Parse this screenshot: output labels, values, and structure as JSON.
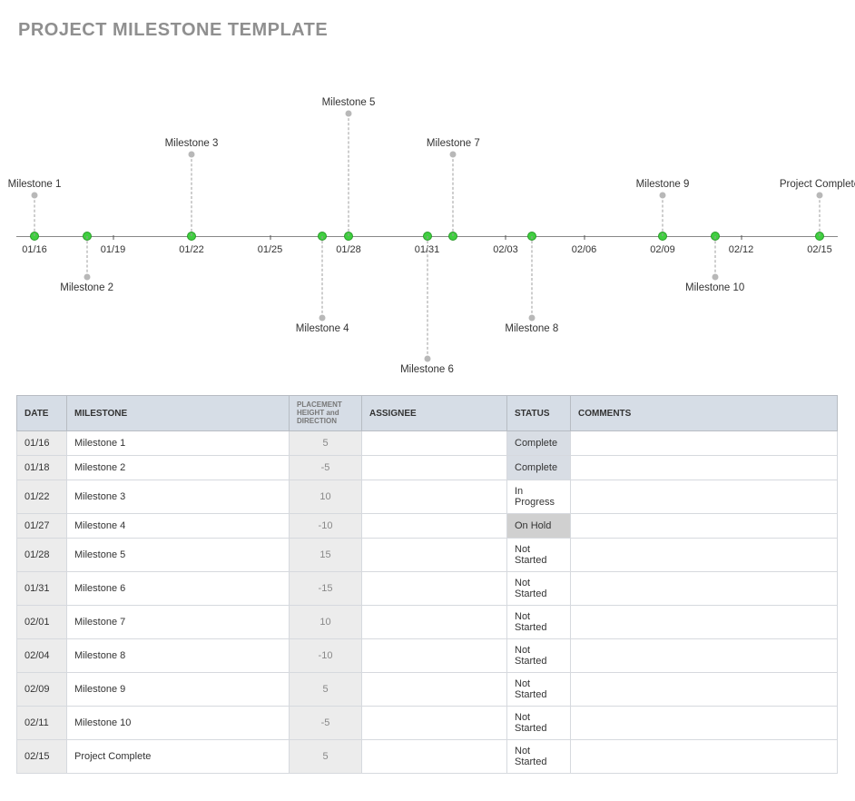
{
  "title": "PROJECT MILESTONE TEMPLATE",
  "chart_data": {
    "type": "scatter",
    "title": "",
    "xlabel": "",
    "ylabel": "",
    "x_ticks": [
      "01/16",
      "01/19",
      "01/22",
      "01/25",
      "01/28",
      "01/31",
      "02/03",
      "02/06",
      "02/09",
      "02/12",
      "02/15"
    ],
    "x_range": [
      "01/16",
      "02/15"
    ],
    "series": [
      {
        "name": "Milestone 1",
        "x": "01/16",
        "height": 5
      },
      {
        "name": "Milestone 2",
        "x": "01/18",
        "height": -5
      },
      {
        "name": "Milestone 3",
        "x": "01/22",
        "height": 10
      },
      {
        "name": "Milestone 4",
        "x": "01/27",
        "height": -10
      },
      {
        "name": "Milestone 5",
        "x": "01/28",
        "height": 15
      },
      {
        "name": "Milestone 6",
        "x": "01/31",
        "height": -15
      },
      {
        "name": "Milestone 7",
        "x": "02/01",
        "height": 10
      },
      {
        "name": "Milestone 8",
        "x": "02/04",
        "height": -10
      },
      {
        "name": "Milestone 9",
        "x": "02/09",
        "height": 5
      },
      {
        "name": "Milestone 10",
        "x": "02/11",
        "height": -5
      },
      {
        "name": "Project Complete",
        "x": "02/15",
        "height": 5
      }
    ]
  },
  "table": {
    "headers": {
      "date": "DATE",
      "milestone": "MILESTONE",
      "placement": "PLACEMENT HEIGHT and DIRECTION",
      "assignee": "ASSIGNEE",
      "status": "STATUS",
      "comments": "COMMENTS"
    },
    "rows": [
      {
        "date": "01/16",
        "milestone": "Milestone 1",
        "placement": "5",
        "assignee": "",
        "status": "Complete",
        "comments": ""
      },
      {
        "date": "01/18",
        "milestone": "Milestone 2",
        "placement": "-5",
        "assignee": "",
        "status": "Complete",
        "comments": ""
      },
      {
        "date": "01/22",
        "milestone": "Milestone 3",
        "placement": "10",
        "assignee": "",
        "status": "In Progress",
        "comments": ""
      },
      {
        "date": "01/27",
        "milestone": "Milestone 4",
        "placement": "-10",
        "assignee": "",
        "status": "On Hold",
        "comments": ""
      },
      {
        "date": "01/28",
        "milestone": "Milestone 5",
        "placement": "15",
        "assignee": "",
        "status": "Not Started",
        "comments": ""
      },
      {
        "date": "01/31",
        "milestone": "Milestone 6",
        "placement": "-15",
        "assignee": "",
        "status": "Not Started",
        "comments": ""
      },
      {
        "date": "02/01",
        "milestone": "Milestone 7",
        "placement": "10",
        "assignee": "",
        "status": "Not Started",
        "comments": ""
      },
      {
        "date": "02/04",
        "milestone": "Milestone 8",
        "placement": "-10",
        "assignee": "",
        "status": "Not Started",
        "comments": ""
      },
      {
        "date": "02/09",
        "milestone": "Milestone 9",
        "placement": "5",
        "assignee": "",
        "status": "Not Started",
        "comments": ""
      },
      {
        "date": "02/11",
        "milestone": "Milestone 10",
        "placement": "-5",
        "assignee": "",
        "status": "Not Started",
        "comments": ""
      },
      {
        "date": "02/15",
        "milestone": "Project Complete",
        "placement": "5",
        "assignee": "",
        "status": "Not Started",
        "comments": ""
      }
    ]
  }
}
